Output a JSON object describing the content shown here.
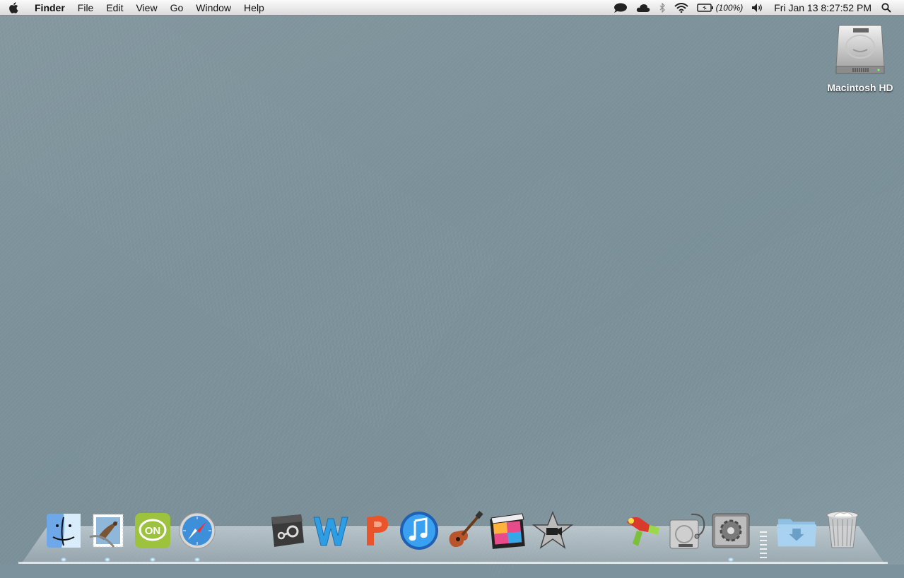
{
  "menubar": {
    "app_name": "Finder",
    "menus": [
      "File",
      "Edit",
      "View",
      "Go",
      "Window",
      "Help"
    ],
    "battery_percent": "(100%)",
    "clock": "Fri Jan 13  8:27:52 PM"
  },
  "desktop": {
    "drive_label": "Macintosh HD"
  },
  "dock": {
    "items": [
      {
        "icon": "finder-icon"
      },
      {
        "icon": "mail-stamp-icon"
      },
      {
        "icon": "nateon-messenger-icon"
      },
      {
        "icon": "safari-icon"
      },
      {
        "icon": "steam-icon"
      },
      {
        "icon": "microsoft-word-icon"
      },
      {
        "icon": "microsoft-powerpoint-icon"
      },
      {
        "icon": "itunes-icon"
      },
      {
        "icon": "garageband-icon"
      },
      {
        "icon": "final-cut-pro-icon"
      },
      {
        "icon": "imovie-icon"
      },
      {
        "icon": "ray-gun-app-icon"
      },
      {
        "icon": "disk-utility-icon"
      },
      {
        "icon": "system-preferences-icon"
      },
      {
        "icon": "downloads-folder-icon"
      },
      {
        "icon": "trash-icon"
      }
    ]
  },
  "colors": {
    "wallpaper": "#7c929c",
    "menubar": "#e8e8e8"
  }
}
